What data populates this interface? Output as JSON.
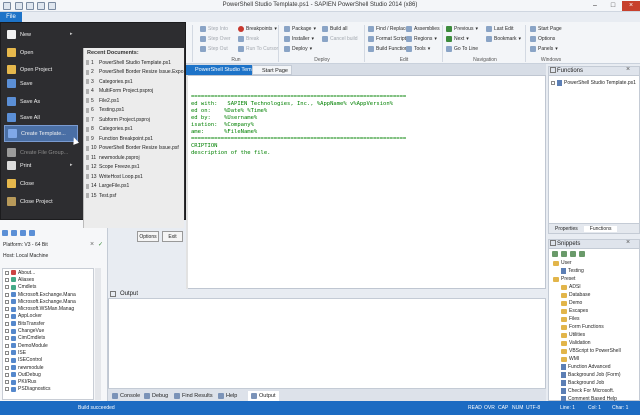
{
  "window": {
    "title": "PowerShell Studio Template.ps1 - SAPIEN PowerShell Studio 2014 (x86)"
  },
  "file_tab": "File",
  "ribbon": {
    "run": {
      "label": "Run",
      "items": [
        "Step Into",
        "Step Over",
        "Step Out",
        "Breakpoints",
        "Break",
        "Run To Cursor"
      ]
    },
    "deploy": {
      "label": "Deploy",
      "items": [
        "Package",
        "Installer",
        "Deploy",
        "Build all",
        "Cancel build"
      ]
    },
    "edit": {
      "label": "Edit",
      "items": [
        "Find / Replace",
        "Format Script",
        "Build Function",
        "Assemblies",
        "Regions",
        "Tools"
      ]
    },
    "navigation": {
      "label": "Navigation",
      "items": [
        "Previous",
        "Next",
        "Go To Line",
        "Last Edit",
        "Bookmark"
      ]
    },
    "windows": {
      "label": "Windows",
      "items": [
        "Start Page",
        "Options",
        "Panels"
      ]
    }
  },
  "file_menu": {
    "items": [
      {
        "label": "New",
        "arrow": true,
        "color": "#f1f1f1"
      },
      {
        "label": "Open",
        "color": "#e6b84c"
      },
      {
        "label": "Open Project",
        "color": "#e6b84c"
      },
      {
        "label": "Save",
        "color": "#5b8fd6"
      },
      {
        "label": "Save As",
        "color": "#5b8fd6"
      },
      {
        "label": "Save All",
        "color": "#5b8fd6"
      },
      {
        "label": "Create Template...",
        "color": "#7fa8e8"
      },
      {
        "label": "Create File Group...",
        "color": "#9b9b9b"
      },
      {
        "label": "Print",
        "arrow": true,
        "color": "#dcdcdc"
      },
      {
        "label": "Close",
        "color": "#e6b84c"
      },
      {
        "label": "Close Project",
        "color": "#b89a5a"
      }
    ],
    "recent_header": "Recent Documents:",
    "recent": [
      "PowerShell Studio Template.ps1",
      "PowerShell Border Resize Issue.Expo...",
      "Categories.ps1",
      "MultiForm Project.psproj",
      "File2.ps1",
      "Testing.ps1",
      "Subform Project.psproj",
      "Categories.ps1",
      "Function Breakpoint.ps1",
      "PowerShell Border Resize Issue.psf",
      "newmodule.psproj",
      "Scope Freeze.ps1",
      "WriteHost Loop.ps1",
      "LargeFile.ps1",
      "Test.psf"
    ],
    "options_label": "Options",
    "exit_label": "Exit"
  },
  "doc_tabs": [
    {
      "label": "PowerShell Studio Template.ps1",
      "active": true
    },
    {
      "label": "Start Page",
      "active": false
    }
  ],
  "editor": {
    "lines": [
      "=================================================================",
      "ed with:   SAPIEN Technologies, Inc., %AppName% v%AppVersion%",
      "ed on:    %Date% %Time%",
      "ed by:    %Username%",
      "isation:  %Company%",
      "ame:      %FileName%",
      "=================================================================",
      "CRIPTION",
      "description of the file."
    ]
  },
  "left_panel": {
    "platform": "Platform: V3 - 64 Bit",
    "host": "Host: Local Machine",
    "tree": [
      "About...",
      "Aliases",
      "Cmdlets",
      "Microsoft.Exchange.Mana",
      "Microsoft.Exchange.Mana",
      "Microsoft.WSMan.Manag",
      "AppLocker",
      "BitsTransfer",
      "ChangeVue",
      "CimCmdlets",
      "DemoModule",
      "ISE",
      "ISEControl",
      "newmodule",
      "OutDebug",
      "PKI/Rus",
      "PSDiagnostics"
    ]
  },
  "output": {
    "title": "Output"
  },
  "bottom_tabs": [
    "Console",
    "Debug",
    "Find Results",
    "Help",
    "Output"
  ],
  "functions_panel": {
    "title": "Functions",
    "items": [
      "PowerShell Studio Template.ps1"
    ],
    "tabs": [
      "Properties",
      "Functions"
    ]
  },
  "snippets_panel": {
    "title": "Snippets",
    "items": [
      {
        "label": "User",
        "level": 0,
        "kind": "folder"
      },
      {
        "label": "Testing",
        "level": 1,
        "kind": "snippet"
      },
      {
        "label": "Preset",
        "level": 0,
        "kind": "folder"
      },
      {
        "label": "ADSI",
        "level": 1,
        "kind": "folder"
      },
      {
        "label": "Database",
        "level": 1,
        "kind": "folder"
      },
      {
        "label": "Demo",
        "level": 1,
        "kind": "folder"
      },
      {
        "label": "Escapes",
        "level": 1,
        "kind": "folder"
      },
      {
        "label": "Files",
        "level": 1,
        "kind": "folder"
      },
      {
        "label": "Form Functions",
        "level": 1,
        "kind": "folder"
      },
      {
        "label": "Utilities",
        "level": 1,
        "kind": "folder"
      },
      {
        "label": "Validation",
        "level": 1,
        "kind": "folder"
      },
      {
        "label": "VBScript to PowerShell",
        "level": 1,
        "kind": "folder"
      },
      {
        "label": "WMI",
        "level": 1,
        "kind": "folder"
      },
      {
        "label": "Function Advanced",
        "level": 1,
        "kind": "snippet"
      },
      {
        "label": "Background Job (Form)",
        "level": 1,
        "kind": "snippet"
      },
      {
        "label": "Background Job",
        "level": 1,
        "kind": "snippet"
      },
      {
        "label": "Check For Microsoft.",
        "level": 1,
        "kind": "snippet"
      },
      {
        "label": "Comment Based Help",
        "level": 1,
        "kind": "snippet"
      }
    ]
  },
  "status": {
    "left": "Build succeeded",
    "items": [
      "READ",
      "OVR",
      "CAP",
      "NUM",
      "UTF-8"
    ],
    "line": "Line: 1",
    "col": "Col: 1",
    "char": "Char: 1"
  }
}
